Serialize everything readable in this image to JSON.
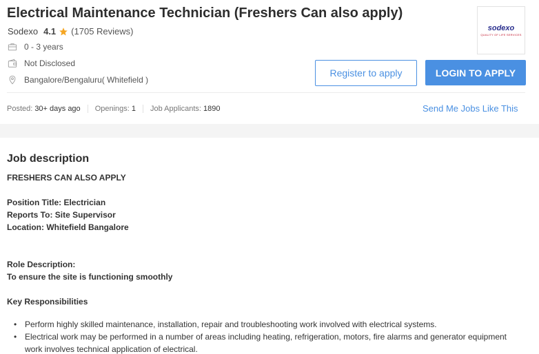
{
  "job": {
    "title": "Electrical Maintenance Technician (Freshers Can also apply)",
    "company": "Sodexo",
    "rating": "4.1",
    "reviews": "(1705 Reviews)",
    "experience": "0 - 3 years",
    "salary": "Not Disclosed",
    "location": "Bangalore/Bengaluru( Whitefield )"
  },
  "logo": {
    "name": "sodexo",
    "tagline": "QUALITY OF LIFE SERVICES"
  },
  "actions": {
    "register_label": "Register to apply",
    "login_label": "LOGIN TO APPLY",
    "send_jobs_label": "Send Me Jobs Like This"
  },
  "stats": {
    "posted_label": "Posted:",
    "posted_value": "30+ days ago",
    "openings_label": "Openings:",
    "openings_value": "1",
    "applicants_label": "Job Applicants:",
    "applicants_value": "1890"
  },
  "description": {
    "heading": "Job description",
    "freshers": "FRESHERS CAN ALSO APPLY",
    "position": "Position Title: Electrician",
    "reports": "Reports To: Site Supervisor",
    "location": "Location: Whitefield Bangalore",
    "role_heading": "Role Description:",
    "role_text": "To ensure the site is functioning smoothly",
    "key_heading": "Key Responsibilities",
    "responsibilities": [
      "Perform highly skilled maintenance, installation, repair and troubleshooting work involved with electrical systems.",
      "Electrical work may be performed in a number of areas including heating, refrigeration, motors, fire alarms and generator equipment work involves technical application of electrical."
    ]
  },
  "colors": {
    "accent": "#4a90e2",
    "star": "#f5a623",
    "logo_blue": "#2a2f8e",
    "logo_red": "#c2192f"
  },
  "icons": {
    "star": "star-icon",
    "experience": "briefcase-icon",
    "salary": "wallet-icon",
    "location": "location-pin-icon"
  }
}
